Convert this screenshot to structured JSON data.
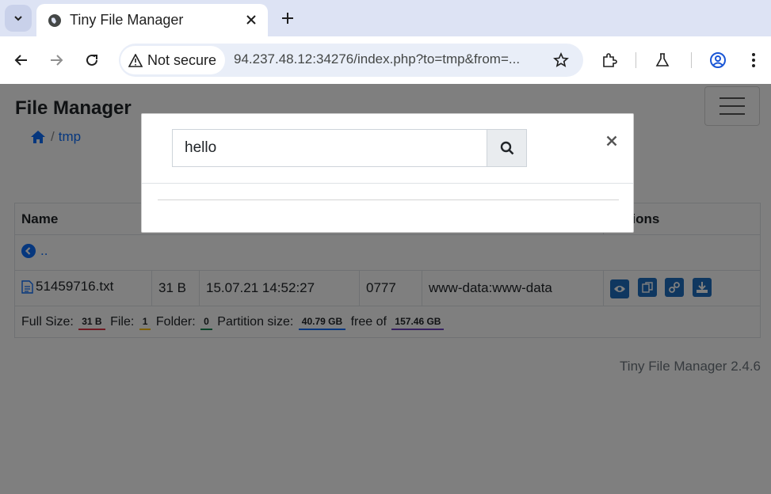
{
  "browser": {
    "tab_title": "Tiny File Manager",
    "security_label": "Not secure",
    "url": "94.237.48.12:34276/index.php?to=tmp&from=..."
  },
  "app": {
    "title": "File Manager",
    "breadcrumb_sep": "/",
    "breadcrumb_folder": "tmp",
    "header_name": "Name",
    "header_actions": "Actions",
    "parent_link": "..",
    "file": {
      "name": "51459716.txt",
      "size": "31 B",
      "modified": "15.07.21 14:52:27",
      "perms": "0777",
      "owner": "www-data:www-data"
    },
    "footer": {
      "full_size_label": "Full Size:",
      "full_size": "31 B",
      "file_label": "File:",
      "file_count": "1",
      "folder_label": "Folder:",
      "folder_count": "0",
      "partition_label": "Partition size:",
      "partition_size": "40.79 GB",
      "free_label": "free of",
      "total_size": "157.46 GB"
    },
    "version": "Tiny File Manager 2.4.6"
  },
  "search_modal": {
    "query": "hello"
  },
  "colors": {
    "full_size_badge": "#dc3545",
    "file_badge": "#ffc107",
    "folder_badge": "#198754",
    "partition_badge": "#0d6efd",
    "total_badge": "#6f42c1"
  }
}
